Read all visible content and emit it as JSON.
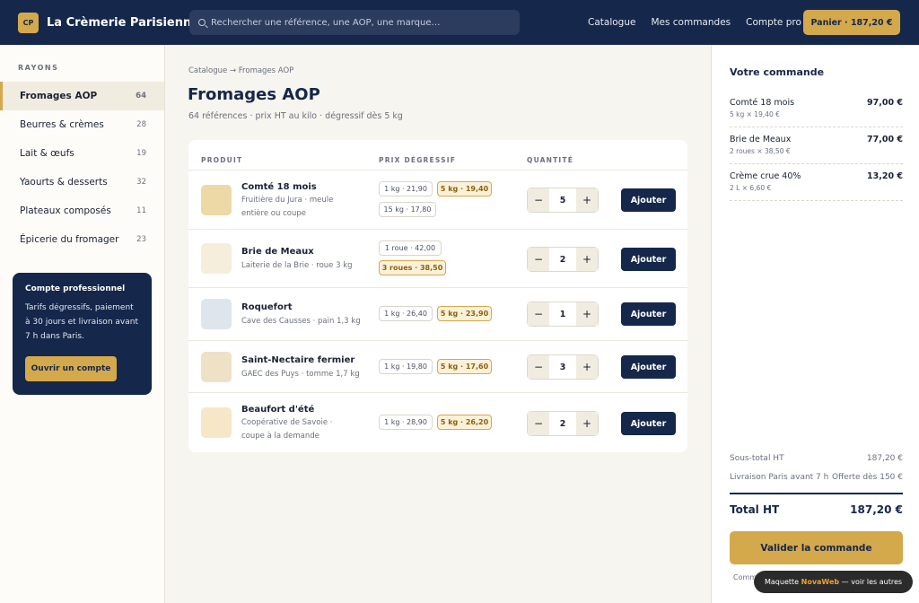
{
  "header": {
    "logo": "CP",
    "brand": "La Crèmerie Parisienne",
    "search_placeholder": "Rechercher une référence, une AOP, une marque…",
    "nav": [
      "Catalogue",
      "Mes commandes",
      "Compte pro"
    ],
    "cart": "Panier · 187,20 €"
  },
  "sidebar": {
    "title": "RAYONS",
    "items": [
      {
        "label": "Fromages AOP",
        "count": "64"
      },
      {
        "label": "Beurres & crèmes",
        "count": "28"
      },
      {
        "label": "Lait & œufs",
        "count": "19"
      },
      {
        "label": "Yaourts & desserts",
        "count": "32"
      },
      {
        "label": "Plateaux composés",
        "count": "11"
      },
      {
        "label": "Épicerie du fromager",
        "count": "23"
      }
    ],
    "pro_card": {
      "title": "Compte professionnel",
      "text": "Tarifs dégressifs, paiement à 30 jours et livraison avant 7 h dans Paris.",
      "button": "Ouvrir un compte"
    }
  },
  "main": {
    "breadcrumb": "Catalogue → Fromages AOP",
    "title": "Fromages AOP",
    "subtitle": "64 références · prix HT au kilo · dégressif dès 5 kg",
    "columns": {
      "product": "PRODUIT",
      "price": "PRIX DÉGRESSIF",
      "qty": "QUANTITÉ"
    },
    "add_label": "Ajouter",
    "products": [
      {
        "name": "Comté 18 mois",
        "desc": "Fruitière du Jura · meule entière ou coupe",
        "tiers": [
          "1 kg · 21,90",
          "5 kg · 19,40",
          "15 kg · 17,80"
        ],
        "qty": "5",
        "color": "#ecd9a6"
      },
      {
        "name": "Brie de Meaux",
        "desc": "Laiterie de la Brie · roue 3 kg",
        "tiers": [
          "1 roue · 42,00",
          "3 roues · 38,50"
        ],
        "qty": "2",
        "color": "#f5eedb"
      },
      {
        "name": "Roquefort",
        "desc": "Cave des Causses · pain 1,3 kg",
        "tiers": [
          "1 kg · 26,40",
          "5 kg · 23,90"
        ],
        "qty": "1",
        "color": "#dee5ec"
      },
      {
        "name": "Saint-Nectaire fermier",
        "desc": "GAEC des Puys · tomme 1,7 kg",
        "tiers": [
          "1 kg · 19,80",
          "5 kg · 17,60"
        ],
        "qty": "3",
        "color": "#efe1c6"
      },
      {
        "name": "Beaufort d'été",
        "desc": "Coopérative de Savoie · coupe à la demande",
        "tiers": [
          "1 kg · 28,90",
          "5 kg · 26,20"
        ],
        "qty": "2",
        "color": "#f6e7c8"
      }
    ]
  },
  "order": {
    "title": "Votre commande",
    "lines": [
      {
        "name": "Comté 18 mois",
        "detail": "5 kg × 19,40 €",
        "price": "97,00 €"
      },
      {
        "name": "Brie de Meaux",
        "detail": "2 roues × 38,50 €",
        "price": "77,00 €"
      },
      {
        "name": "Crème crue 40%",
        "detail": "2 L × 6,60 €",
        "price": "13,20 €"
      }
    ],
    "subtotal_label": "Sous-total HT",
    "subtotal": "187,20 €",
    "delivery_label": "Livraison Paris avant 7 h",
    "delivery": "Offerte dès 150 €",
    "total_label": "Total HT",
    "total": "187,20 €",
    "validate": "Valider la commande",
    "note": "Comm"
  },
  "badge": {
    "prefix": "Maquette",
    "brand": "NovaWeb",
    "suffix": "— voir les autres"
  }
}
